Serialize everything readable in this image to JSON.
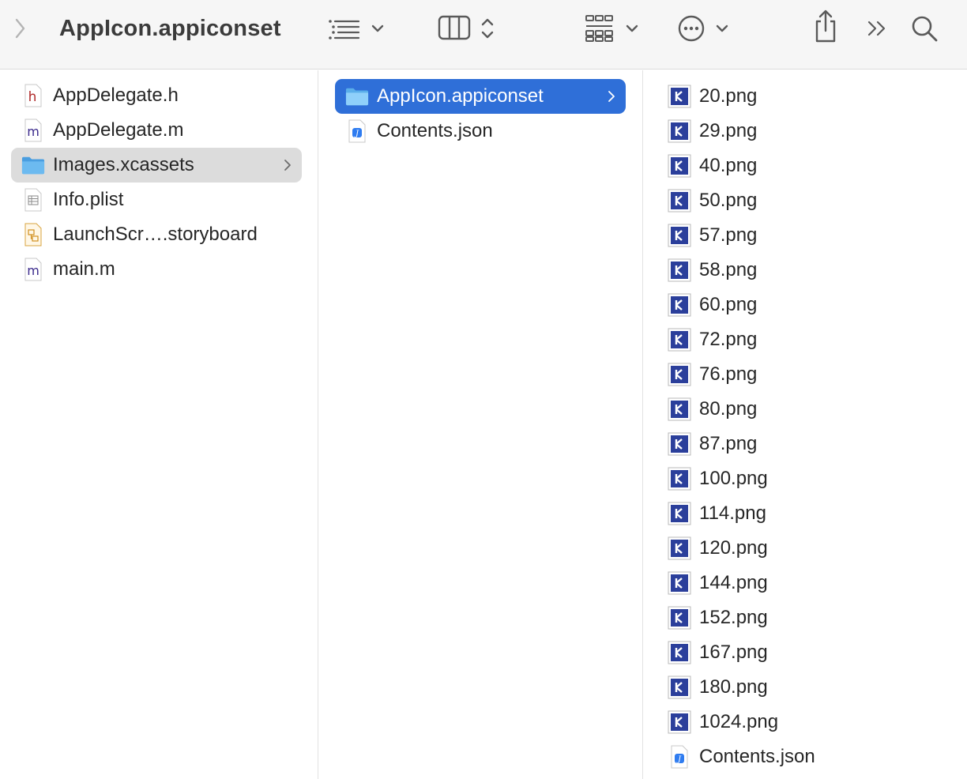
{
  "window": {
    "title": "AppIcon.appiconset"
  },
  "toolbar": {
    "icons": [
      "back-chevron-icon",
      "list-view-icon",
      "chevron-down-icon",
      "column-view-icon",
      "sort-updown-icon",
      "gallery-grid-icon",
      "chevron-down-icon",
      "more-ellipsis-icon",
      "chevron-down-icon",
      "share-icon",
      "overflow-chevrons-icon",
      "search-icon"
    ]
  },
  "column1": {
    "items": [
      {
        "label": "AppDelegate.h",
        "icon": "h-header-file-icon"
      },
      {
        "label": "AppDelegate.m",
        "icon": "m-source-file-icon"
      },
      {
        "label": "Images.xcassets",
        "icon": "folder-icon",
        "selected": true
      },
      {
        "label": "Info.plist",
        "icon": "plist-file-icon"
      },
      {
        "label": "LaunchScr….storyboard",
        "icon": "storyboard-file-icon"
      },
      {
        "label": "main.m",
        "icon": "m-source-file-icon"
      }
    ]
  },
  "column2": {
    "items": [
      {
        "label": "AppIcon.appiconset",
        "icon": "folder-icon",
        "selected": true
      },
      {
        "label": "Contents.json",
        "icon": "json-file-icon"
      }
    ]
  },
  "column3": {
    "items": [
      {
        "label": "20.png"
      },
      {
        "label": "29.png"
      },
      {
        "label": "40.png"
      },
      {
        "label": "50.png"
      },
      {
        "label": "57.png"
      },
      {
        "label": "58.png"
      },
      {
        "label": "60.png"
      },
      {
        "label": "72.png"
      },
      {
        "label": "76.png"
      },
      {
        "label": "80.png"
      },
      {
        "label": "87.png"
      },
      {
        "label": "100.png"
      },
      {
        "label": "114.png"
      },
      {
        "label": "120.png"
      },
      {
        "label": "144.png"
      },
      {
        "label": "152.png"
      },
      {
        "label": "167.png"
      },
      {
        "label": "180.png"
      },
      {
        "label": "1024.png"
      },
      {
        "label": "Contents.json",
        "icon": "json-file-icon"
      }
    ]
  },
  "colors": {
    "selection_blue": "#2f6fd8",
    "selection_gray": "#dcdcdc",
    "folder_blue": "#5fb0ec",
    "png_icon_blue": "#2b3f9b"
  }
}
